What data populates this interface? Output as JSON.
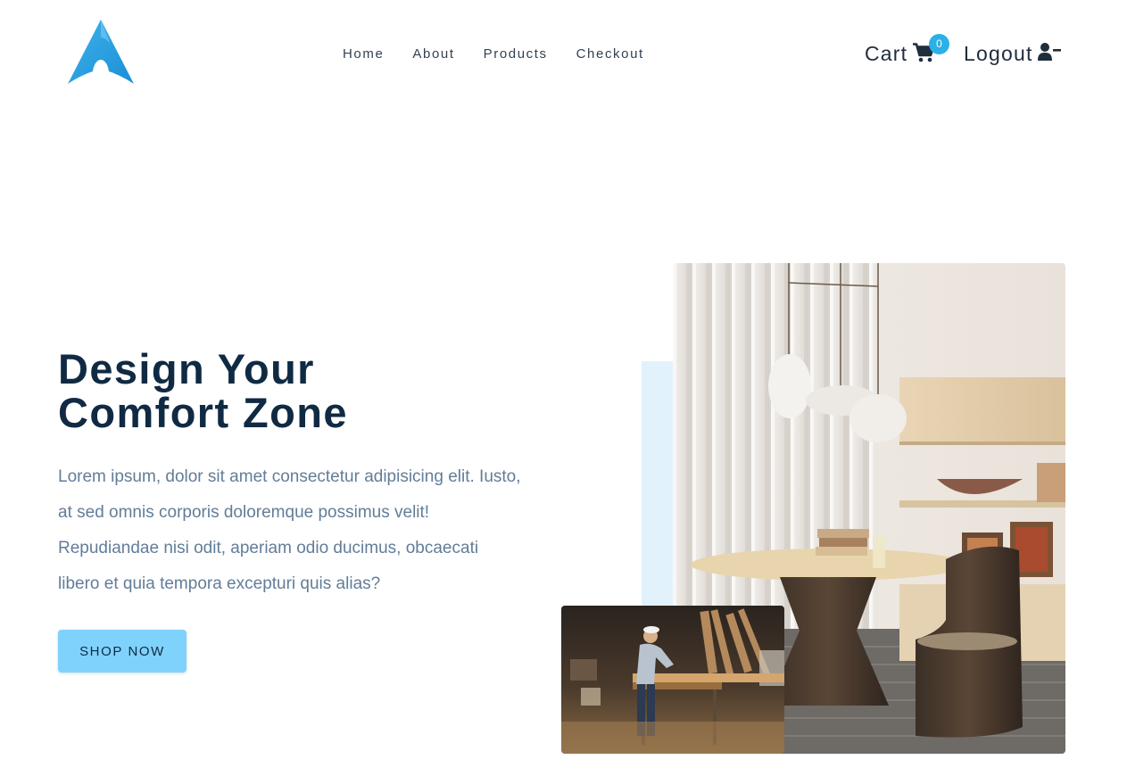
{
  "nav": {
    "links": [
      "Home",
      "About",
      "Products",
      "Checkout"
    ],
    "cart_label": "Cart",
    "cart_count": "0",
    "logout_label": "Logout",
    "icons": {
      "logo": "arch-logo-icon",
      "cart": "shopping-cart-icon",
      "logout": "user-minus-icon"
    }
  },
  "hero": {
    "title_line1": "Design Your",
    "title_line2": "Comfort Zone",
    "text": "Lorem ipsum, dolor sit amet consectetur adipisicing elit. Iusto, at sed omnis corporis doloremque possimus velit! Repudiandae nisi odit, aperiam odio ducimus, obcaecati libero et quia tempora excepturi quis alias?",
    "button_label": "SHOP NOW"
  },
  "colors": {
    "primary_dark": "#102a43",
    "text_grey": "#627d98",
    "button_bg": "#7fd2fc",
    "badge_bg": "#2cb0e8",
    "accent_light": "#e1f2fd"
  }
}
